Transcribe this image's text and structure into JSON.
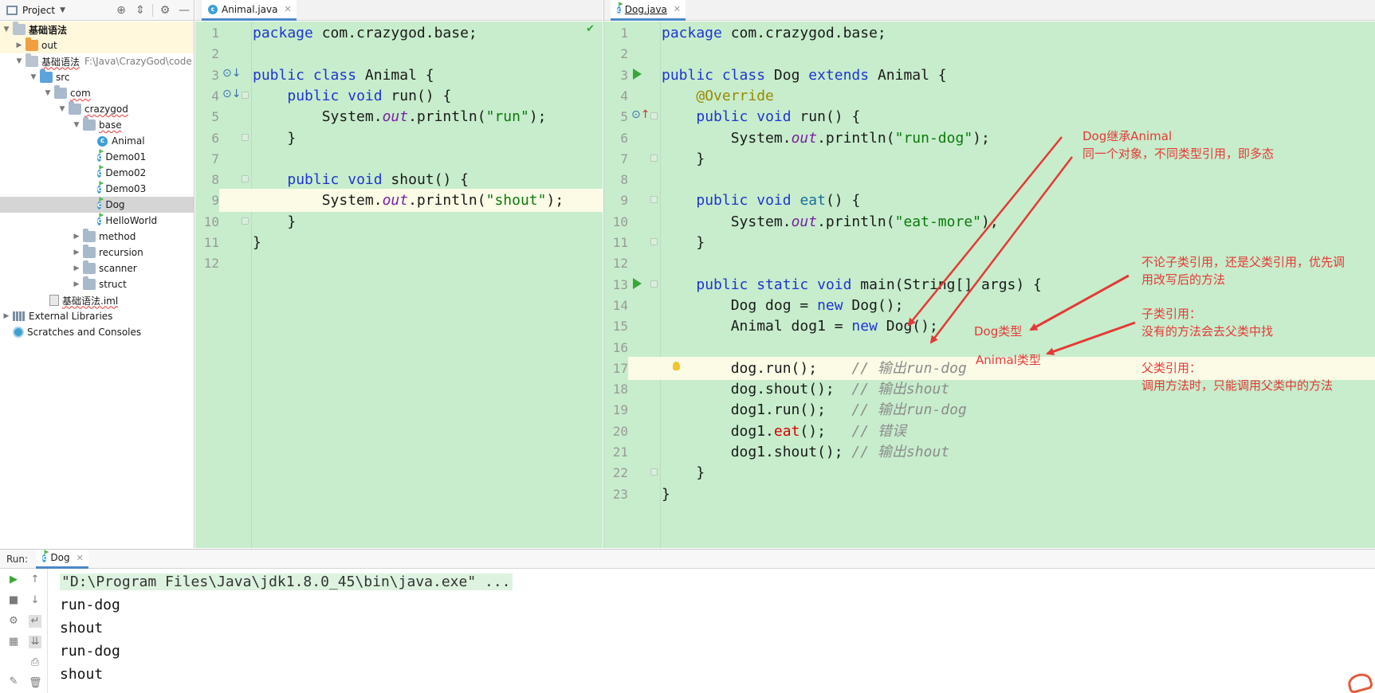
{
  "project_panel": {
    "title": "Project",
    "tree": [
      {
        "label": "基础语法",
        "hint": ""
      },
      {
        "label": "out",
        "hint": ""
      },
      {
        "label": "基础语法",
        "hint": "F:\\Java\\CrazyGod\\code"
      },
      {
        "label": "src",
        "hint": ""
      },
      {
        "label": "com",
        "hint": ""
      },
      {
        "label": "crazygod",
        "hint": ""
      },
      {
        "label": "base",
        "hint": ""
      },
      {
        "label": "Animal",
        "hint": ""
      },
      {
        "label": "Demo01",
        "hint": ""
      },
      {
        "label": "Demo02",
        "hint": ""
      },
      {
        "label": "Demo03",
        "hint": ""
      },
      {
        "label": "Dog",
        "hint": ""
      },
      {
        "label": "HelloWorld",
        "hint": ""
      },
      {
        "label": "method",
        "hint": ""
      },
      {
        "label": "recursion",
        "hint": ""
      },
      {
        "label": "scanner",
        "hint": ""
      },
      {
        "label": "struct",
        "hint": ""
      },
      {
        "label": "基础语法.iml",
        "hint": ""
      },
      {
        "label": "External Libraries",
        "hint": ""
      },
      {
        "label": "Scratches and Consoles",
        "hint": ""
      }
    ]
  },
  "left_editor": {
    "tab_label": "Animal.java",
    "line_numbers": [
      "1",
      "2",
      "3",
      "4",
      "5",
      "6",
      "7",
      "8",
      "9",
      "10",
      "11",
      "12"
    ],
    "lines": [
      "package com.crazygod.base;",
      "",
      "public class Animal {",
      "    public void run() {",
      "        System.out.println(\"run\");",
      "    }",
      "",
      "    public void shout() {",
      "        System.out.println(\"shout\");",
      "    }",
      "}",
      ""
    ]
  },
  "right_editor": {
    "tab_label": "Dog.java",
    "line_numbers": [
      "1",
      "2",
      "3",
      "4",
      "5",
      "6",
      "7",
      "8",
      "9",
      "10",
      "11",
      "12",
      "13",
      "14",
      "15",
      "16",
      "17",
      "18",
      "19",
      "20",
      "21",
      "22",
      "23"
    ],
    "lines": [
      "package com.crazygod.base;",
      "",
      "public class Dog extends Animal {",
      "    @Override",
      "    public void run() {",
      "        System.out.println(\"run-dog\");",
      "    }",
      "",
      "    public void eat() {",
      "        System.out.println(\"eat-more\");",
      "    }",
      "",
      "    public static void main(String[] args) {",
      "        Dog dog = new Dog();",
      "        Animal dog1 = new Dog();",
      "",
      "        dog.run();    // 输出run-dog",
      "        dog.shout();  // 输出shout",
      "        dog1.run();   // 输出run-dog",
      "        dog1.eat();   // 错误",
      "        dog1.shout(); // 输出shout",
      "    }",
      "}"
    ]
  },
  "annotations": {
    "note1_line1": "Dog继承Animal",
    "note1_line2": "同一个对象，不同类型引用，即多态",
    "note2_line1": "不论子类引用，还是父类引用，优先调",
    "note2_line2": "用改写后的方法",
    "note3_line1": "子类引用：",
    "note3_line2": "没有的方法会去父类中找",
    "note4_line1": "父类引用：",
    "note4_line2": "调用方法时，只能调用父类中的方法",
    "dog_type": "Dog类型",
    "animal_type": "Animal类型",
    "color": "#e53935"
  },
  "run_panel": {
    "label": "Run:",
    "tab_label": "Dog",
    "output": [
      "\"D:\\Program Files\\Java\\jdk1.8.0_45\\bin\\java.exe\" ...",
      "run-dog",
      "shout",
      "run-dog",
      "shout"
    ]
  },
  "colors": {
    "editor_bg": "#c7edcc",
    "keyword": "#1f35d0",
    "string": "#0b7a0b",
    "tab_underline": "#4a88c7"
  }
}
